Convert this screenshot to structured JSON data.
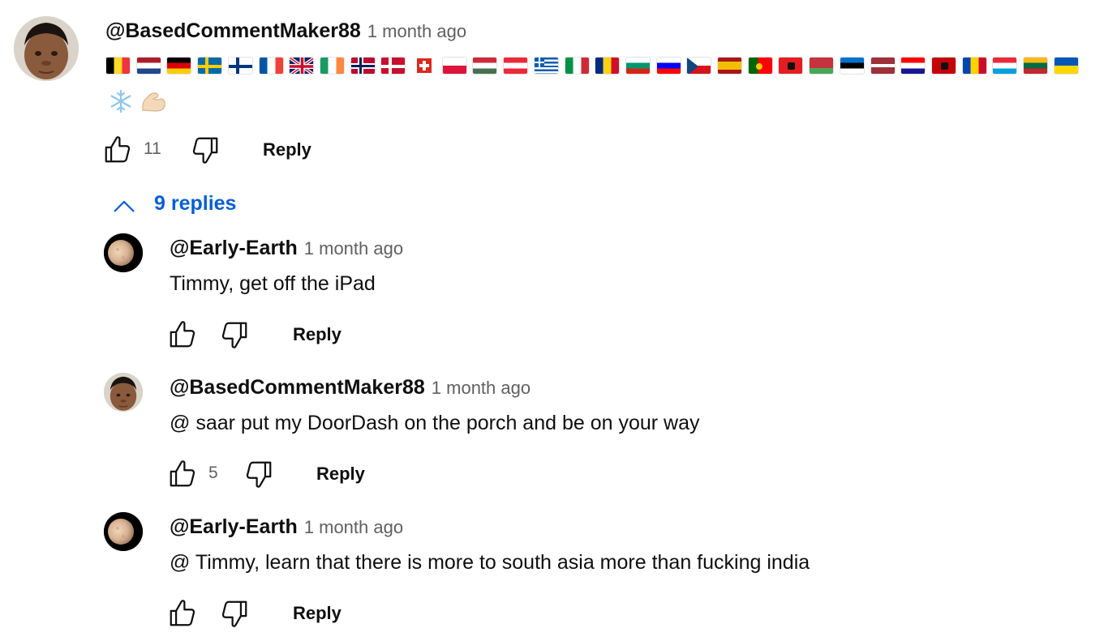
{
  "colors": {
    "link_blue": "#065fd4",
    "meta_gray": "#606060",
    "text": "#0f0f0f"
  },
  "icons": {
    "like": "thumbs-up-icon",
    "dislike": "thumbs-down-icon",
    "collapse": "chevron-up-icon",
    "snowflake": "snowflake-icon",
    "muscle": "flexed-biceps-icon"
  },
  "top_comment": {
    "author": "@BasedCommentMaker88",
    "time": "1 month ago",
    "flags": [
      "BE",
      "NL",
      "DE",
      "SE",
      "FI",
      "FR",
      "GB",
      "IE",
      "NO",
      "DK",
      "CH",
      "PL",
      "HU",
      "AT",
      "GR",
      "IT",
      "RO",
      "BG",
      "SI",
      "CZ",
      "ES",
      "PT",
      "AL",
      "BY",
      "EE",
      "LV",
      "HR",
      "ME",
      "MD",
      "LU",
      "LT",
      "UA"
    ],
    "like_count": "11",
    "reply_label": "Reply"
  },
  "replies_toggle": {
    "label": "9 replies"
  },
  "replies": [
    {
      "author": "@Early-Earth",
      "time": "1 month ago",
      "text": "Timmy, get off the iPad",
      "like_count": "",
      "reply_label": "Reply"
    },
    {
      "author": "@BasedCommentMaker88",
      "time": "1 month ago",
      "text": "@ saar put my DoorDash on the porch and be on your way",
      "like_count": "5",
      "reply_label": "Reply"
    },
    {
      "author": "@Early-Earth",
      "time": "1 month ago",
      "text": "@ Timmy, learn that there is more to south asia more than fucking india",
      "like_count": "",
      "reply_label": "Reply"
    }
  ]
}
